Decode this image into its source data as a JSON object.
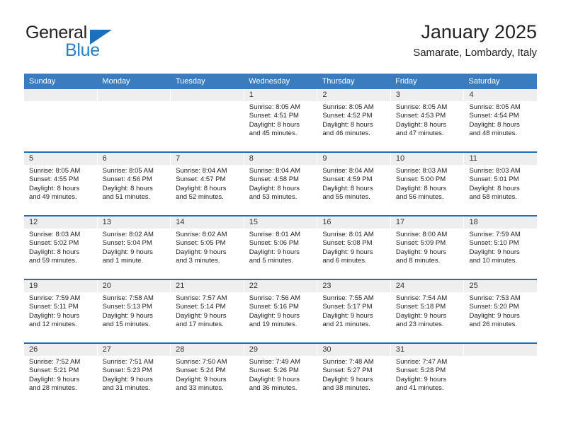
{
  "brand": {
    "name_top": "General",
    "name_bottom": "Blue",
    "triangle_color": "#1c6fba",
    "blue_color": "#2980c4"
  },
  "header": {
    "title": "January 2025",
    "subtitle": "Samarate, Lombardy, Italy"
  },
  "theme": {
    "header_bar": "#3a7cbe",
    "week_divider": "#1c6fba",
    "daynum_band": "#eeeeee"
  },
  "weekdays": [
    "Sunday",
    "Monday",
    "Tuesday",
    "Wednesday",
    "Thursday",
    "Friday",
    "Saturday"
  ],
  "weeks": [
    [
      {
        "day": "",
        "empty": true
      },
      {
        "day": "",
        "empty": true
      },
      {
        "day": "",
        "empty": true
      },
      {
        "day": "1",
        "sunrise": "Sunrise: 8:05 AM",
        "sunset": "Sunset: 4:51 PM",
        "daylight1": "Daylight: 8 hours",
        "daylight2": "and 45 minutes."
      },
      {
        "day": "2",
        "sunrise": "Sunrise: 8:05 AM",
        "sunset": "Sunset: 4:52 PM",
        "daylight1": "Daylight: 8 hours",
        "daylight2": "and 46 minutes."
      },
      {
        "day": "3",
        "sunrise": "Sunrise: 8:05 AM",
        "sunset": "Sunset: 4:53 PM",
        "daylight1": "Daylight: 8 hours",
        "daylight2": "and 47 minutes."
      },
      {
        "day": "4",
        "sunrise": "Sunrise: 8:05 AM",
        "sunset": "Sunset: 4:54 PM",
        "daylight1": "Daylight: 8 hours",
        "daylight2": "and 48 minutes."
      }
    ],
    [
      {
        "day": "5",
        "sunrise": "Sunrise: 8:05 AM",
        "sunset": "Sunset: 4:55 PM",
        "daylight1": "Daylight: 8 hours",
        "daylight2": "and 49 minutes."
      },
      {
        "day": "6",
        "sunrise": "Sunrise: 8:05 AM",
        "sunset": "Sunset: 4:56 PM",
        "daylight1": "Daylight: 8 hours",
        "daylight2": "and 51 minutes."
      },
      {
        "day": "7",
        "sunrise": "Sunrise: 8:04 AM",
        "sunset": "Sunset: 4:57 PM",
        "daylight1": "Daylight: 8 hours",
        "daylight2": "and 52 minutes."
      },
      {
        "day": "8",
        "sunrise": "Sunrise: 8:04 AM",
        "sunset": "Sunset: 4:58 PM",
        "daylight1": "Daylight: 8 hours",
        "daylight2": "and 53 minutes."
      },
      {
        "day": "9",
        "sunrise": "Sunrise: 8:04 AM",
        "sunset": "Sunset: 4:59 PM",
        "daylight1": "Daylight: 8 hours",
        "daylight2": "and 55 minutes."
      },
      {
        "day": "10",
        "sunrise": "Sunrise: 8:03 AM",
        "sunset": "Sunset: 5:00 PM",
        "daylight1": "Daylight: 8 hours",
        "daylight2": "and 56 minutes."
      },
      {
        "day": "11",
        "sunrise": "Sunrise: 8:03 AM",
        "sunset": "Sunset: 5:01 PM",
        "daylight1": "Daylight: 8 hours",
        "daylight2": "and 58 minutes."
      }
    ],
    [
      {
        "day": "12",
        "sunrise": "Sunrise: 8:03 AM",
        "sunset": "Sunset: 5:02 PM",
        "daylight1": "Daylight: 8 hours",
        "daylight2": "and 59 minutes."
      },
      {
        "day": "13",
        "sunrise": "Sunrise: 8:02 AM",
        "sunset": "Sunset: 5:04 PM",
        "daylight1": "Daylight: 9 hours",
        "daylight2": "and 1 minute."
      },
      {
        "day": "14",
        "sunrise": "Sunrise: 8:02 AM",
        "sunset": "Sunset: 5:05 PM",
        "daylight1": "Daylight: 9 hours",
        "daylight2": "and 3 minutes."
      },
      {
        "day": "15",
        "sunrise": "Sunrise: 8:01 AM",
        "sunset": "Sunset: 5:06 PM",
        "daylight1": "Daylight: 9 hours",
        "daylight2": "and 5 minutes."
      },
      {
        "day": "16",
        "sunrise": "Sunrise: 8:01 AM",
        "sunset": "Sunset: 5:08 PM",
        "daylight1": "Daylight: 9 hours",
        "daylight2": "and 6 minutes."
      },
      {
        "day": "17",
        "sunrise": "Sunrise: 8:00 AM",
        "sunset": "Sunset: 5:09 PM",
        "daylight1": "Daylight: 9 hours",
        "daylight2": "and 8 minutes."
      },
      {
        "day": "18",
        "sunrise": "Sunrise: 7:59 AM",
        "sunset": "Sunset: 5:10 PM",
        "daylight1": "Daylight: 9 hours",
        "daylight2": "and 10 minutes."
      }
    ],
    [
      {
        "day": "19",
        "sunrise": "Sunrise: 7:59 AM",
        "sunset": "Sunset: 5:11 PM",
        "daylight1": "Daylight: 9 hours",
        "daylight2": "and 12 minutes."
      },
      {
        "day": "20",
        "sunrise": "Sunrise: 7:58 AM",
        "sunset": "Sunset: 5:13 PM",
        "daylight1": "Daylight: 9 hours",
        "daylight2": "and 15 minutes."
      },
      {
        "day": "21",
        "sunrise": "Sunrise: 7:57 AM",
        "sunset": "Sunset: 5:14 PM",
        "daylight1": "Daylight: 9 hours",
        "daylight2": "and 17 minutes."
      },
      {
        "day": "22",
        "sunrise": "Sunrise: 7:56 AM",
        "sunset": "Sunset: 5:16 PM",
        "daylight1": "Daylight: 9 hours",
        "daylight2": "and 19 minutes."
      },
      {
        "day": "23",
        "sunrise": "Sunrise: 7:55 AM",
        "sunset": "Sunset: 5:17 PM",
        "daylight1": "Daylight: 9 hours",
        "daylight2": "and 21 minutes."
      },
      {
        "day": "24",
        "sunrise": "Sunrise: 7:54 AM",
        "sunset": "Sunset: 5:18 PM",
        "daylight1": "Daylight: 9 hours",
        "daylight2": "and 23 minutes."
      },
      {
        "day": "25",
        "sunrise": "Sunrise: 7:53 AM",
        "sunset": "Sunset: 5:20 PM",
        "daylight1": "Daylight: 9 hours",
        "daylight2": "and 26 minutes."
      }
    ],
    [
      {
        "day": "26",
        "sunrise": "Sunrise: 7:52 AM",
        "sunset": "Sunset: 5:21 PM",
        "daylight1": "Daylight: 9 hours",
        "daylight2": "and 28 minutes."
      },
      {
        "day": "27",
        "sunrise": "Sunrise: 7:51 AM",
        "sunset": "Sunset: 5:23 PM",
        "daylight1": "Daylight: 9 hours",
        "daylight2": "and 31 minutes."
      },
      {
        "day": "28",
        "sunrise": "Sunrise: 7:50 AM",
        "sunset": "Sunset: 5:24 PM",
        "daylight1": "Daylight: 9 hours",
        "daylight2": "and 33 minutes."
      },
      {
        "day": "29",
        "sunrise": "Sunrise: 7:49 AM",
        "sunset": "Sunset: 5:26 PM",
        "daylight1": "Daylight: 9 hours",
        "daylight2": "and 36 minutes."
      },
      {
        "day": "30",
        "sunrise": "Sunrise: 7:48 AM",
        "sunset": "Sunset: 5:27 PM",
        "daylight1": "Daylight: 9 hours",
        "daylight2": "and 38 minutes."
      },
      {
        "day": "31",
        "sunrise": "Sunrise: 7:47 AM",
        "sunset": "Sunset: 5:28 PM",
        "daylight1": "Daylight: 9 hours",
        "daylight2": "and 41 minutes."
      },
      {
        "day": "",
        "empty": true
      }
    ]
  ]
}
